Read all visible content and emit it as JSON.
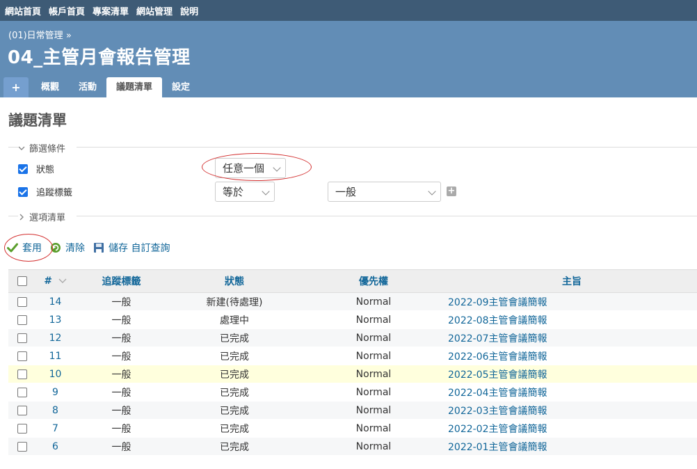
{
  "top_menu": [
    "網站首頁",
    "帳戶首頁",
    "專案清單",
    "網站管理",
    "說明"
  ],
  "header": {
    "breadcrumb": "(01)日常管理 »",
    "project_title": "04_主管月會報告管理"
  },
  "tabs": {
    "new": "+",
    "overview": "概觀",
    "activity": "活動",
    "issues": "議題清單",
    "settings": "設定"
  },
  "page_heading": "議題清單",
  "filters": {
    "legend": "篩選條件",
    "status_label": "狀態",
    "status_operator": "任意一個",
    "tracker_label": "追蹤標籤",
    "tracker_operator": "等於",
    "tracker_value": "一般",
    "options_legend": "選項清單"
  },
  "buttons": {
    "apply": "套用",
    "clear": "清除",
    "save": "儲存 自訂查詢"
  },
  "table": {
    "headers": {
      "id": "#",
      "tracker": "追蹤標籤",
      "status": "狀態",
      "priority": "優先權",
      "subject": "主旨"
    },
    "rows": [
      {
        "id": "14",
        "tracker": "一般",
        "status": "新建(待處理)",
        "priority": "Normal",
        "subject": "2022-09主管會議簡報"
      },
      {
        "id": "13",
        "tracker": "一般",
        "status": "處理中",
        "priority": "Normal",
        "subject": "2022-08主管會議簡報"
      },
      {
        "id": "12",
        "tracker": "一般",
        "status": "已完成",
        "priority": "Normal",
        "subject": "2022-07主管會議簡報"
      },
      {
        "id": "11",
        "tracker": "一般",
        "status": "已完成",
        "priority": "Normal",
        "subject": "2022-06主管會議簡報"
      },
      {
        "id": "10",
        "tracker": "一般",
        "status": "已完成",
        "priority": "Normal",
        "subject": "2022-05主管會議簡報"
      },
      {
        "id": "9",
        "tracker": "一般",
        "status": "已完成",
        "priority": "Normal",
        "subject": "2022-04主管會議簡報"
      },
      {
        "id": "8",
        "tracker": "一般",
        "status": "已完成",
        "priority": "Normal",
        "subject": "2022-03主管會議簡報"
      },
      {
        "id": "7",
        "tracker": "一般",
        "status": "已完成",
        "priority": "Normal",
        "subject": "2022-02主管會議簡報"
      },
      {
        "id": "6",
        "tracker": "一般",
        "status": "已完成",
        "priority": "Normal",
        "subject": "2022-01主管會議簡報"
      }
    ]
  },
  "colors": {
    "top_menu_bg": "#3e5b76",
    "header_bg": "#628db6",
    "link": "#169",
    "highlight_row": "#ffffdd",
    "annotation": "#d32f2f"
  }
}
